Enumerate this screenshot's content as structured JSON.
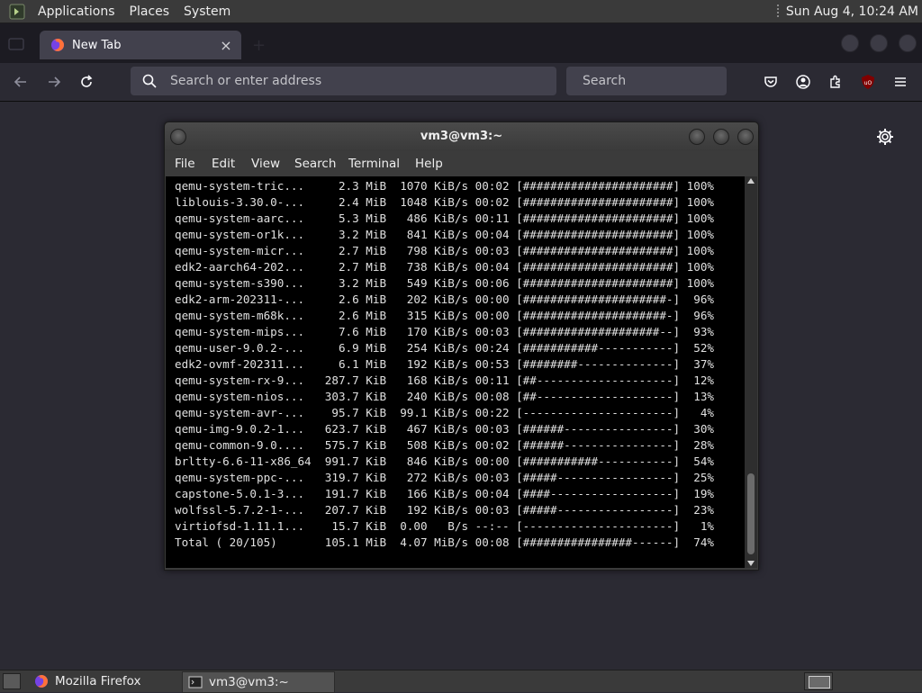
{
  "top_panel": {
    "menus": [
      "Applications",
      "Places",
      "System"
    ],
    "clock": "Sun Aug  4, 10:24 AM"
  },
  "browser": {
    "tab_title": "New Tab",
    "address_placeholder": "Search or enter address",
    "search_placeholder": "Search",
    "toolbar_icons": [
      "pocket-icon",
      "account-icon",
      "extensions-icon",
      "ublock-icon",
      "menu-icon"
    ]
  },
  "terminal": {
    "title": "vm3@vm3:~",
    "menu": [
      "File",
      "Edit",
      "View",
      "Search",
      "Terminal",
      "Help"
    ],
    "lines": [
      "qemu-system-tric...     2.3 MiB  1070 KiB/s 00:02 [######################] 100%",
      "liblouis-3.30.0-...     2.4 MiB  1048 KiB/s 00:02 [######################] 100%",
      "qemu-system-aarc...     5.3 MiB   486 KiB/s 00:11 [######################] 100%",
      "qemu-system-or1k...     3.2 MiB   841 KiB/s 00:04 [######################] 100%",
      "qemu-system-micr...     2.7 MiB   798 KiB/s 00:03 [######################] 100%",
      "edk2-aarch64-202...     2.7 MiB   738 KiB/s 00:04 [######################] 100%",
      "qemu-system-s390...     3.2 MiB   549 KiB/s 00:06 [######################] 100%",
      "edk2-arm-202311-...     2.6 MiB   202 KiB/s 00:00 [#####################-]  96%",
      "qemu-system-m68k...     2.6 MiB   315 KiB/s 00:00 [#####################-]  96%",
      "qemu-system-mips...     7.6 MiB   170 KiB/s 00:03 [####################--]  93%",
      "qemu-user-9.0.2-...     6.9 MiB   254 KiB/s 00:24 [###########-----------]  52%",
      "edk2-ovmf-202311...     6.1 MiB   192 KiB/s 00:53 [########--------------]  37%",
      "qemu-system-rx-9...   287.7 KiB   168 KiB/s 00:11 [##--------------------]  12%",
      "qemu-system-nios...   303.7 KiB   240 KiB/s 00:08 [##--------------------]  13%",
      "qemu-system-avr-...    95.7 KiB  99.1 KiB/s 00:22 [----------------------]   4%",
      "qemu-img-9.0.2-1...   623.7 KiB   467 KiB/s 00:03 [######----------------]  30%",
      "qemu-common-9.0....   575.7 KiB   508 KiB/s 00:02 [######----------------]  28%",
      "brltty-6.6-11-x86_64  991.7 KiB   846 KiB/s 00:00 [###########-----------]  54%",
      "qemu-system-ppc-...   319.7 KiB   272 KiB/s 00:03 [#####-----------------]  25%",
      "capstone-5.0.1-3...   191.7 KiB   166 KiB/s 00:04 [####------------------]  19%",
      "wolfssl-5.7.2-1-...   207.7 KiB   192 KiB/s 00:03 [#####-----------------]  23%",
      "virtiofsd-1.11.1...    15.7 KiB  0.00   B/s --:-- [----------------------]   1%",
      "Total ( 20/105)       105.1 MiB  4.07 MiB/s 00:08 [################------]  74%"
    ]
  },
  "taskbar": {
    "tasks": [
      {
        "label": "Mozilla Firefox",
        "icon": "firefox-icon"
      },
      {
        "label": "vm3@vm3:~",
        "icon": "terminal-icon"
      }
    ]
  },
  "colors": {
    "panel": "#3a3a3a",
    "browser_bg": "#2b2a33",
    "terminal_bg": "#000000",
    "text": "#e0e0e0"
  }
}
